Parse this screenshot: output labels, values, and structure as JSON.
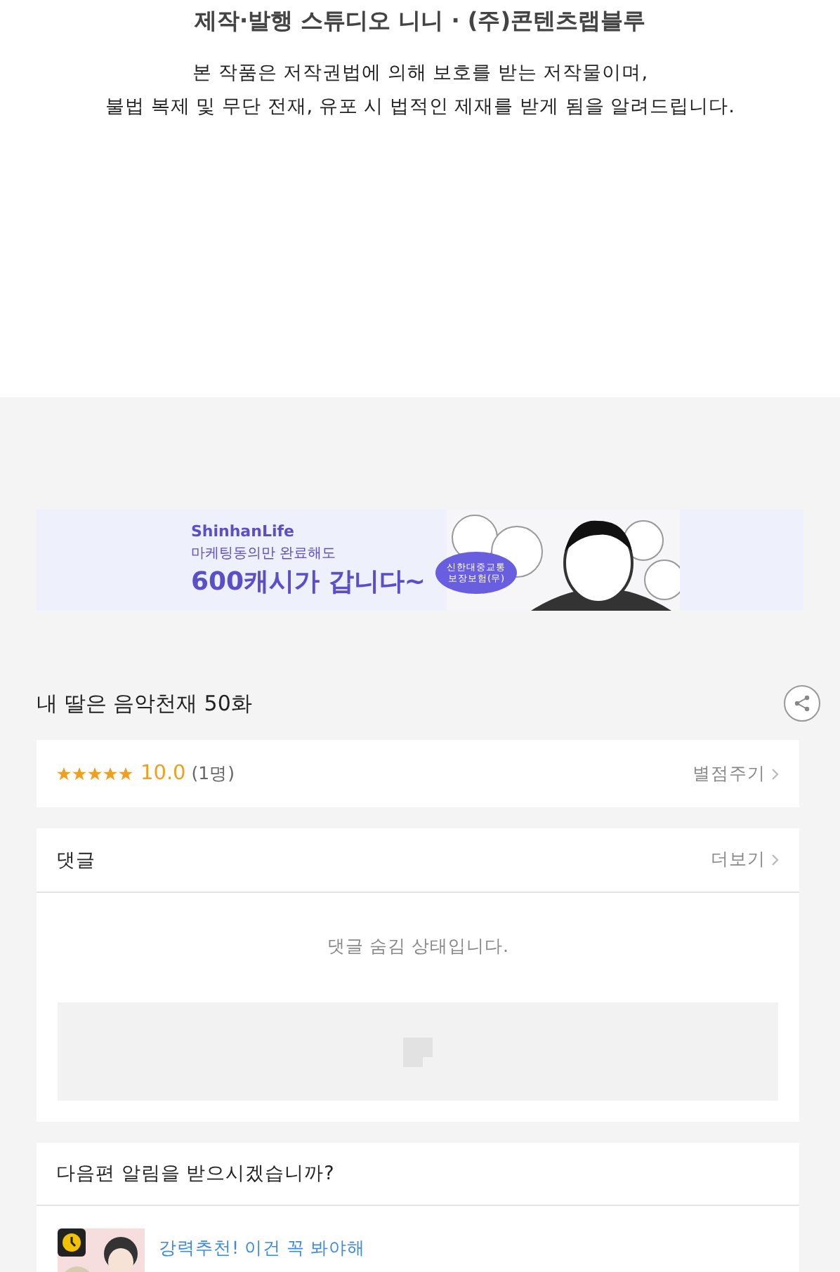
{
  "credits": "제작·발행 스튜디오 니니 · (주)콘텐츠랩블루",
  "notice": [
    "본 작품은 저작권법에 의해 보호를 받는 저작물이며,",
    "불법 복제 및 무단 전재, 유포 시 법적인 제재를 받게 됨을 알려드립니다."
  ],
  "banner": {
    "brand": "ShinhanLife",
    "line": "마케팅동의만 완료해도",
    "headline": "600캐시가 갑니다~",
    "bubble": [
      "신한대중교통",
      "보장보험(무)"
    ]
  },
  "episode_title": "내 딸은 음악천재 50화",
  "rating": {
    "stars": 5,
    "score": "10.0",
    "count": "(1명)",
    "action": "별점주기"
  },
  "comments": {
    "title": "댓글",
    "more": "더보기",
    "message": "댓글 숨김 상태입니다."
  },
  "notify": {
    "question": "다음편 알림을 받으시겠습니까?",
    "items": [
      {
        "tag": "강력추천! 이건 꼭 봐야해"
      }
    ]
  }
}
